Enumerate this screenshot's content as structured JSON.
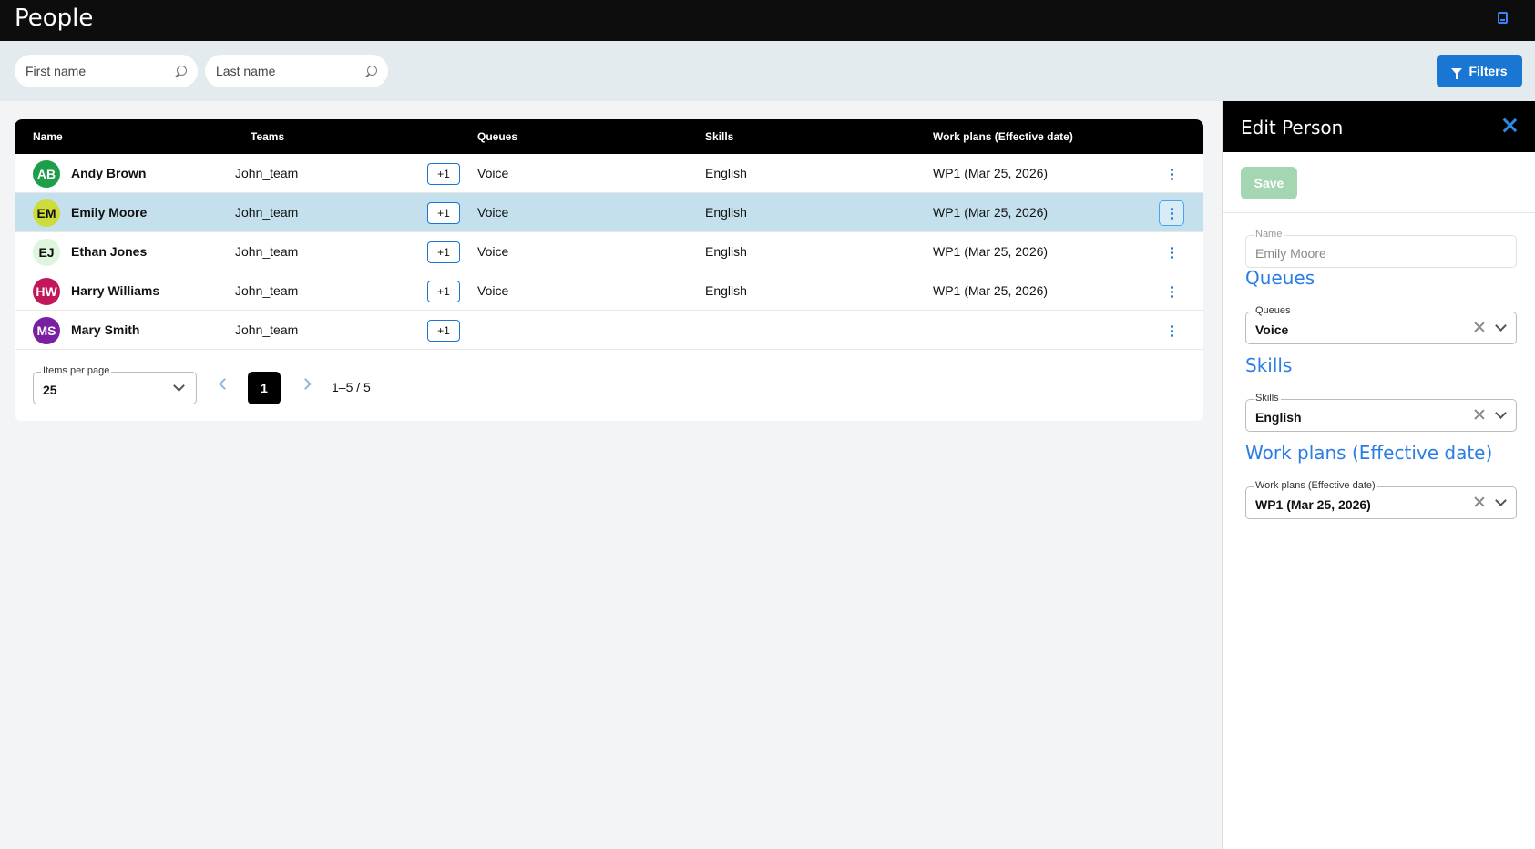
{
  "header": {
    "title": "People",
    "help_icon": "book-icon"
  },
  "search": {
    "first_placeholder": "First name",
    "last_placeholder": "Last name"
  },
  "toolbar": {
    "filters_label": "Filters"
  },
  "table": {
    "columns": [
      "Name",
      "Teams",
      "Queues",
      "Skills",
      "Work plans (Effective date)"
    ],
    "rows": [
      {
        "initials": "AB",
        "name": "Andy Brown",
        "team": "John_team",
        "extra": "+1",
        "queue": "Voice",
        "skill": "English",
        "plan": "WP1 (Mar 25, 2026)",
        "avatar_color": "#1e9e4a",
        "avatar_text": "#ffffff"
      },
      {
        "initials": "EM",
        "name": "Emily Moore",
        "team": "John_team",
        "extra": "+1",
        "queue": "Voice",
        "skill": "English",
        "plan": "WP1 (Mar 25, 2026)",
        "avatar_color": "#cddc39",
        "avatar_text": "#111111"
      },
      {
        "initials": "EJ",
        "name": "Ethan Jones",
        "team": "John_team",
        "extra": "+1",
        "queue": "Voice",
        "skill": "English",
        "plan": "WP1 (Mar 25, 2026)",
        "avatar_color": "#dff5df",
        "avatar_text": "#111111"
      },
      {
        "initials": "HW",
        "name": "Harry Williams",
        "team": "John_team",
        "extra": "+1",
        "queue": "Voice",
        "skill": "English",
        "plan": "WP1 (Mar 25, 2026)",
        "avatar_color": "#c2185b",
        "avatar_text": "#ffffff"
      },
      {
        "initials": "MS",
        "name": "Mary Smith",
        "team": "John_team",
        "extra": "+1",
        "queue": "",
        "skill": "",
        "plan": "",
        "avatar_color": "#7b1fa2",
        "avatar_text": "#ffffff"
      }
    ],
    "selected_index": 1
  },
  "pagination": {
    "items_label": "Items per page",
    "items_value": "25",
    "current_page": "1",
    "range": "1–5 / 5"
  },
  "panel": {
    "title": "Edit Person",
    "save_label": "Save",
    "name_label": "Name",
    "name_value": "Emily Moore",
    "queues_heading": "Queues",
    "queues_label": "Queues",
    "queues_value": "Voice",
    "skills_heading": "Skills",
    "skills_label": "Skills",
    "skills_value": "English",
    "plans_heading": "Work plans (Effective date)",
    "plans_label": "Work plans (Effective date)",
    "plans_value": "WP1 (Mar 25, 2026)"
  },
  "colors": {
    "accent": "#1976d2",
    "heading_blue": "#2b7de6",
    "selected_row": "#c3e0ec",
    "save_disabled": "#a5d6b2"
  }
}
